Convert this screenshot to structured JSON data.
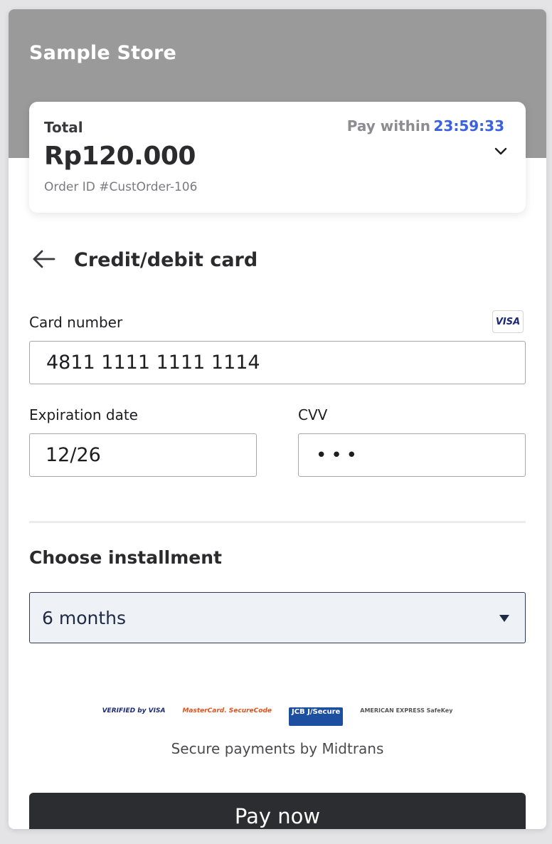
{
  "store": {
    "name": "Sample Store"
  },
  "summary": {
    "total_label": "Total",
    "total_amount": "Rp120.000",
    "order_id": "Order ID #CustOrder-106",
    "pay_within_label": "Pay within",
    "timer": "23:59:33"
  },
  "payment_method": {
    "title": "Credit/debit card"
  },
  "card_form": {
    "card_number_label": "Card number",
    "card_number_value": "4811 1111 1111 1114",
    "card_brand": "VISA",
    "expiration_label": "Expiration date",
    "expiration_value": "12/26",
    "cvv_label": "CVV",
    "cvv_value": "•••"
  },
  "installment": {
    "title": "Choose installment",
    "selected": "6 months"
  },
  "security": {
    "logos": [
      "VERIFIED by VISA",
      "MasterCard. SecureCode",
      "JCB J/Secure",
      "AMERICAN EXPRESS SafeKey"
    ],
    "text": "Secure payments by Midtrans"
  },
  "actions": {
    "pay_label": "Pay now"
  },
  "colors": {
    "header_bg": "#9a9a9a",
    "timer": "#3a62e0",
    "pay_button_bg": "#2c2d30",
    "select_bg": "#eef1f6"
  }
}
